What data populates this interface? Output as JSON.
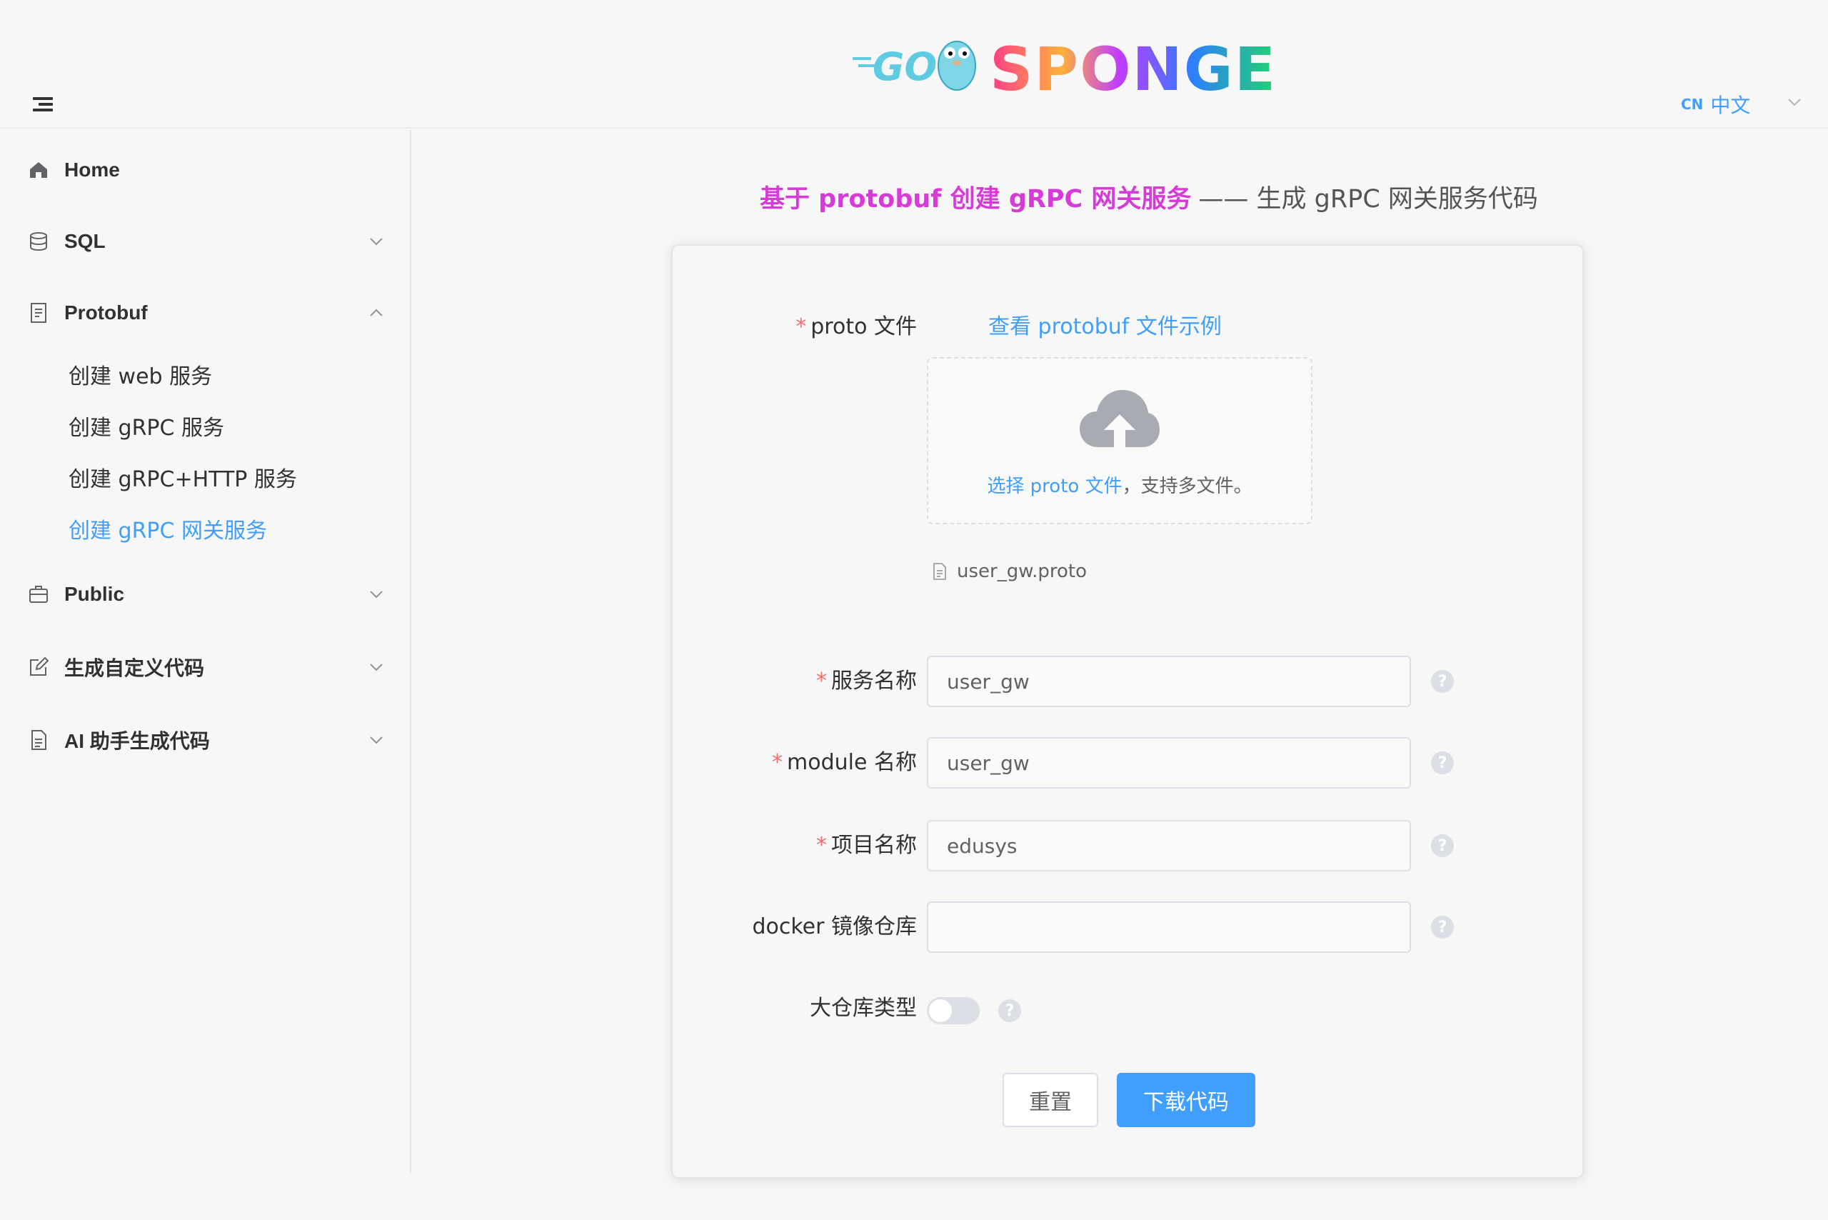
{
  "header": {
    "logo_text": "GO SPONGE",
    "lang_code": "CN",
    "lang_label": "中文"
  },
  "sidebar": {
    "items": [
      {
        "label": "Home"
      },
      {
        "label": "SQL"
      },
      {
        "label": "Protobuf"
      },
      {
        "label": "Public"
      },
      {
        "label": "生成自定义代码"
      },
      {
        "label": "AI 助手生成代码"
      }
    ],
    "protobuf_sub": [
      {
        "label": "创建 web 服务"
      },
      {
        "label": "创建 gRPC 服务"
      },
      {
        "label": "创建 gRPC+HTTP 服务"
      },
      {
        "label": "创建 gRPC 网关服务"
      }
    ]
  },
  "main": {
    "title_accent": "基于 protobuf 创建 gRPC 网关服务",
    "title_rest": "—— 生成 gRPC 网关服务代码"
  },
  "form": {
    "proto_label": "proto 文件",
    "proto_example_link": "查看 protobuf 文件示例",
    "upload_text_link": "选择 proto 文件",
    "upload_text_rest": "，支持多文件。",
    "uploaded_file": "user_gw.proto",
    "fields": [
      {
        "label": "服务名称",
        "value": "user_gw",
        "required": true
      },
      {
        "label": "module 名称",
        "value": "user_gw",
        "required": true
      },
      {
        "label": "项目名称",
        "value": "edusys",
        "required": true
      },
      {
        "label": "docker 镜像仓库",
        "value": "",
        "required": false
      }
    ],
    "monorepo_label": "大仓库类型",
    "monorepo_enabled": false,
    "required_mark": "*",
    "help_mark": "?",
    "reset_button": "重置",
    "download_button": "下载代码"
  },
  "colors": {
    "accent": "#409eff",
    "title_accent": "#d63bd8",
    "required": "#f56c6c"
  }
}
